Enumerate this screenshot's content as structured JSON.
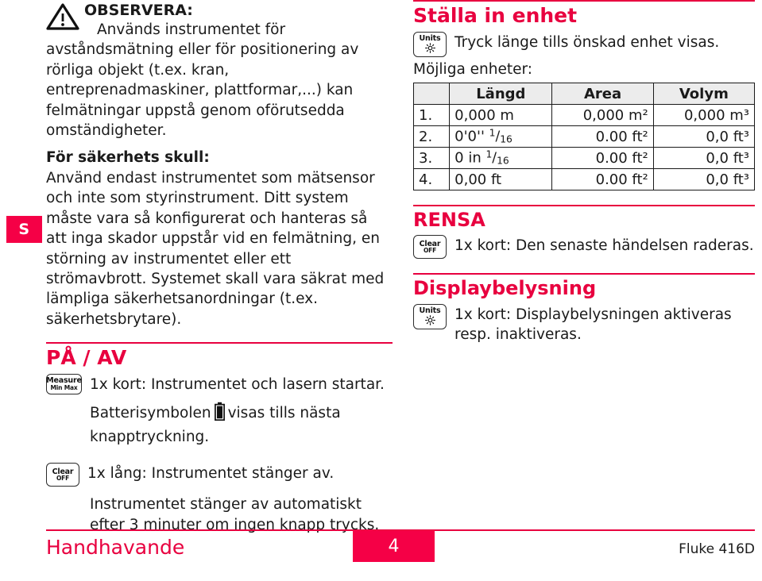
{
  "accent_color": "#F50046",
  "accent_rule_color": "#E8003F",
  "side_tab": {
    "label": "S"
  },
  "left_column": {
    "notice": {
      "icon": "warning-triangle-icon",
      "title": "OBSERVERA:",
      "body": "Används instrumentet för avståndsmätning eller för positionering av rörliga objekt (t.ex. kran, entreprenadmaskiner, plattformar,...) kan felmätningar uppstå genom oförutsedda omständigheter."
    },
    "safety": {
      "heading": "För säkerhets skull:",
      "body": "Använd endast instrumentet som mätsensor och inte som styrinstrument. Ditt system måste vara så konfigurerat och hanteras så att inga skador uppstår vid en felmätning, en störning av instrumentet eller ett strömavbrott. Systemet skall vara säkrat med lämpliga säkerhetsanordningar (t.ex. säkerhetsbrytare)."
    },
    "onoff": {
      "heading": "PÅ / AV",
      "rows": [
        {
          "button": {
            "line1": "Measure",
            "line2": "Min Max",
            "icon": "measure-minmax-button"
          },
          "text": "1x kort: Instrumentet och lasern startar."
        },
        {
          "button": {
            "line1": "Clear",
            "line2": "OFF",
            "icon": "clear-off-button"
          },
          "text": "1x lång: Instrumentet stänger av."
        }
      ],
      "battery_text_before": "Batterisymbolen",
      "battery_icon": "battery-icon",
      "battery_text_after": "visas tills nästa knapptryckning.",
      "auto_off_text": "Instrumentet stänger av automatiskt efter 3 minuter om ingen knapp trycks."
    }
  },
  "right_column": {
    "unit_setting": {
      "heading": "Ställa in enhet",
      "button": {
        "line1": "Units",
        "icon": "units-brightness-button"
      },
      "instruction": "Tryck länge tills önskad enhet visas.",
      "subtitle": "Möjliga enheter:"
    },
    "units_table": {
      "columns": [
        "",
        "Längd",
        "Area",
        "Volym"
      ],
      "rows": [
        {
          "idx": "1.",
          "length_plain": "0,000 m",
          "length_num": "",
          "length_den": "",
          "area": "0,000 m²",
          "volume": "0,000 m³"
        },
        {
          "idx": "2.",
          "length_plain": "0'0'' ",
          "length_num": "1",
          "length_den": "16",
          "area": "0.00 ft²",
          "volume": "0,0 ft³"
        },
        {
          "idx": "3.",
          "length_plain": "0 in ",
          "length_num": "1",
          "length_den": "16",
          "area": "0.00 ft²",
          "volume": "0,0 ft³"
        },
        {
          "idx": "4.",
          "length_plain": "0,00 ft",
          "length_num": "",
          "length_den": "",
          "area": "0.00 ft²",
          "volume": "0,0 ft³"
        }
      ]
    },
    "clear_section": {
      "heading": "RENSA",
      "button": {
        "line1": "Clear",
        "line2": "OFF",
        "icon": "clear-off-button"
      },
      "text": "1x kort: Den senaste händelsen raderas."
    },
    "backlight_section": {
      "heading": "Displaybelysning",
      "button": {
        "line1": "Units",
        "icon": "units-brightness-button"
      },
      "text": "1x kort: Displaybelysningen aktiveras resp. inaktiveras."
    }
  },
  "footer": {
    "left_label": "Handhavande",
    "page_number": "4",
    "right_label": "Fluke 416D"
  }
}
